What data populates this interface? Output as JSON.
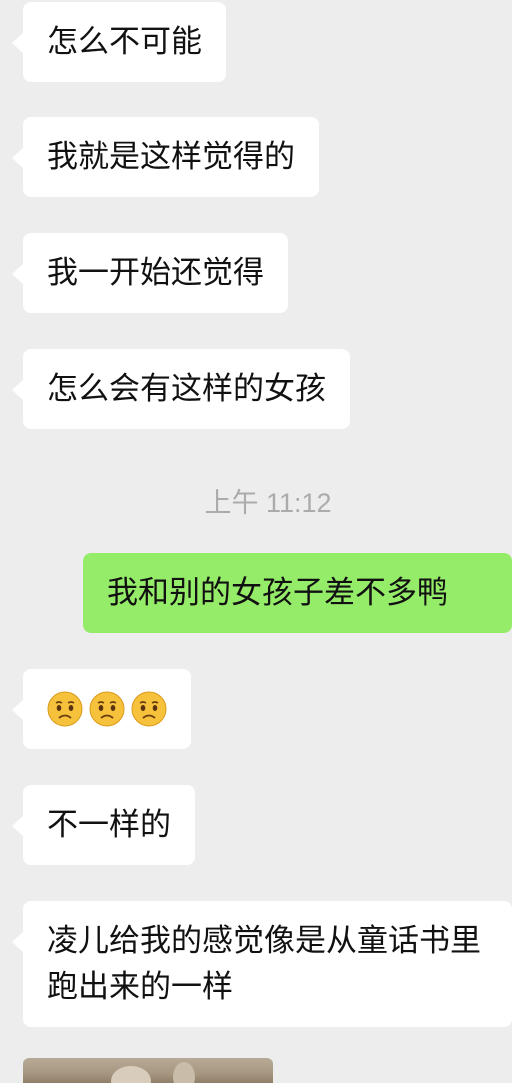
{
  "messages": [
    {
      "side": "left",
      "text": "怎么不可能"
    },
    {
      "side": "left",
      "text": "我就是这样觉得的"
    },
    {
      "side": "left",
      "text": "我一开始还觉得"
    },
    {
      "side": "left",
      "text": "怎么会有这样的女孩"
    },
    {
      "timestamp": "上午 11:12"
    },
    {
      "side": "right",
      "text": "我和别的女孩子差不多鸭"
    },
    {
      "side": "left",
      "emoji": [
        "sad-face-emoji",
        "sad-face-emoji",
        "sad-face-emoji"
      ]
    },
    {
      "side": "left",
      "text": "不一样的"
    },
    {
      "side": "left",
      "text": "凌儿给我的感觉像是从童话书里跑出来的一样"
    },
    {
      "side": "left",
      "image": "photo-thumbnail"
    }
  ],
  "colors": {
    "background": "#ededed",
    "incoming_bubble": "#ffffff",
    "outgoing_bubble": "#95ec69",
    "timestamp_text": "#ababab"
  }
}
